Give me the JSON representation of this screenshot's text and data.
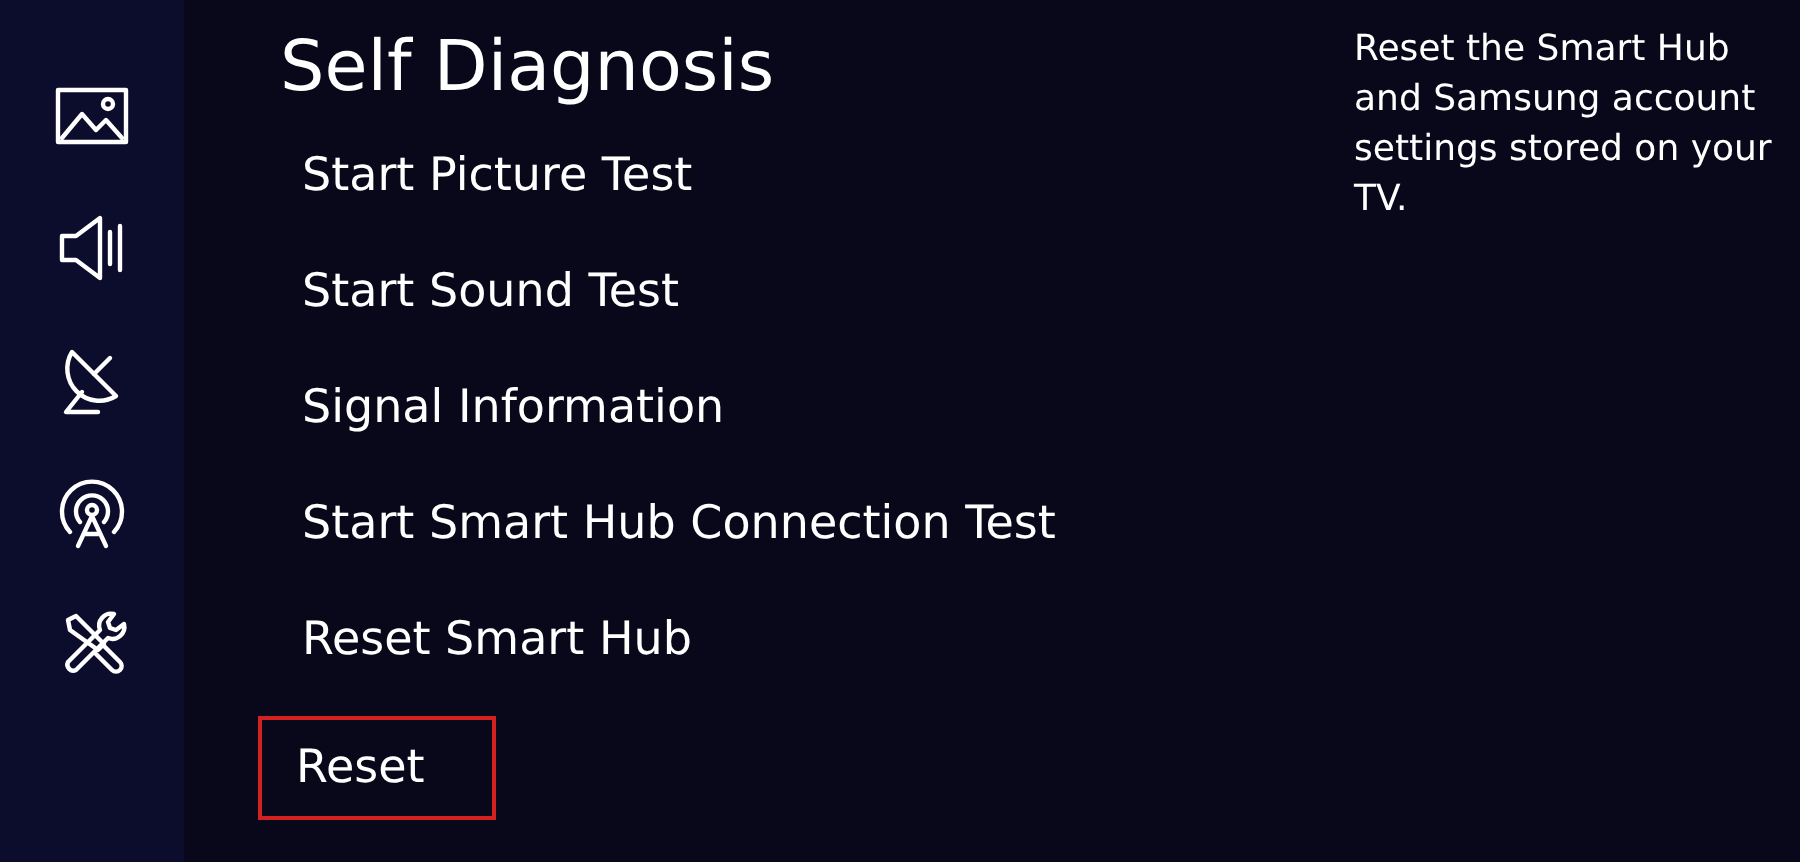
{
  "title": "Self Diagnosis",
  "menu": [
    {
      "label": "Start Picture Test",
      "highlighted": false
    },
    {
      "label": "Start Sound Test",
      "highlighted": false
    },
    {
      "label": "Signal Information",
      "highlighted": false
    },
    {
      "label": "Start Smart Hub Connection Test",
      "highlighted": false
    },
    {
      "label": "Reset Smart Hub",
      "highlighted": false
    },
    {
      "label": "Reset",
      "highlighted": true
    }
  ],
  "description": "Reset the Smart Hub and Samsung account settings stored on your TV."
}
